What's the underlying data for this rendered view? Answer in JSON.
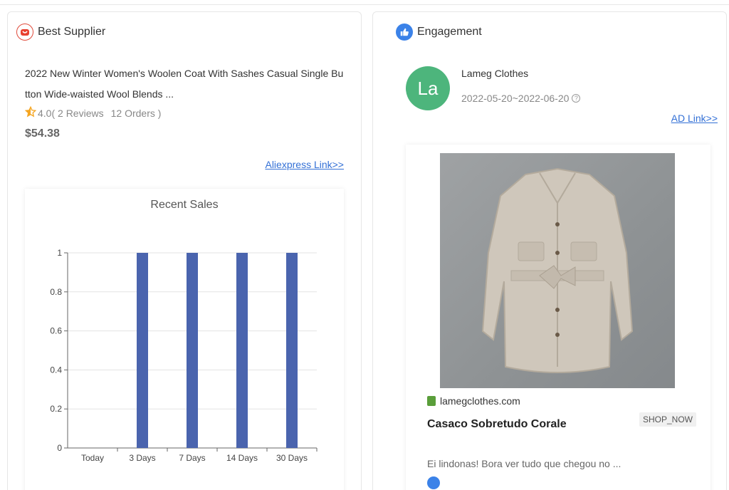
{
  "supplier": {
    "header_title": "Best Supplier",
    "product_title": "2022 New Winter Women's Woolen Coat With Sashes Casual Single Button Wide-waisted Wool Blends ...",
    "rating": "4.0",
    "reviews": "( 2 Reviews",
    "orders": "12 Orders )",
    "price": "$54.38",
    "link_label": "Aliexpress Link>>"
  },
  "engagement": {
    "header_title": "Engagement",
    "avatar_initials": "La",
    "advertiser_name": "Lameg Clothes",
    "date_range": "2022-05-20~2022-06-20",
    "ad_link_label": "AD Link>>",
    "ad": {
      "domain": "lamegclothes.com",
      "title": "Casaco Sobretudo Corale",
      "cta_label": "SHOP_NOW",
      "body": "Ei lindonas! Bora ver tudo que chegou no ..."
    }
  },
  "colors": {
    "bar": "#4a64ae",
    "link": "#3370d6",
    "avatar": "#4db57c"
  },
  "chart_data": {
    "type": "bar",
    "title": "Recent Sales",
    "categories": [
      "Today",
      "3 Days",
      "7 Days",
      "14 Days",
      "30 Days"
    ],
    "values": [
      0,
      1,
      1,
      1,
      1
    ],
    "yticks": [
      "0",
      "0.2",
      "0.4",
      "0.6",
      "0.8",
      "1"
    ],
    "ylim": [
      0,
      1
    ],
    "grid": true
  }
}
